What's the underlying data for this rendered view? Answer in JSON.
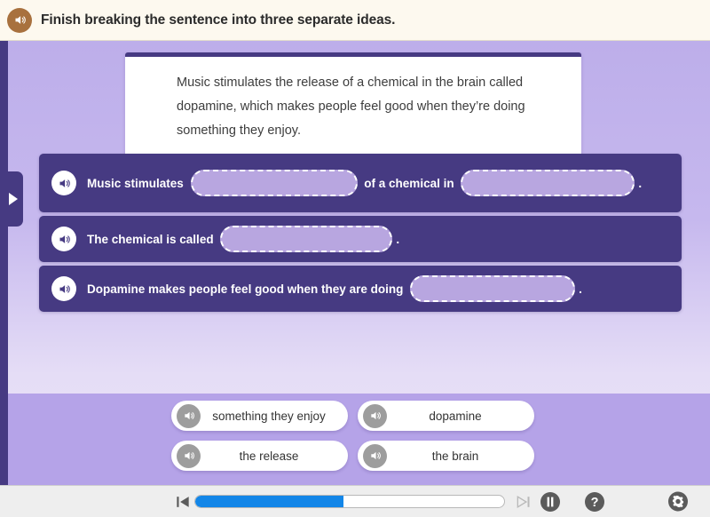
{
  "header": {
    "audio_icon": "speaker-icon",
    "instruction": "Finish breaking the sentence into three separate ideas."
  },
  "sentence_card": {
    "text": "Music stimulates the release of a chemical in the brain called dopamine, which makes people feel good when they’re doing something they enjoy."
  },
  "expander": {
    "icon": "triangle-right-icon"
  },
  "answer_rows": [
    {
      "audio_icon": "speaker-icon",
      "lead": "Music stimulates ",
      "blank1_value": "",
      "middle": " of a chemical in ",
      "blank2_value": "",
      "end": "."
    },
    {
      "audio_icon": "speaker-icon",
      "lead": "The chemical is called ",
      "blank1_value": "",
      "end": "."
    },
    {
      "audio_icon": "speaker-icon",
      "lead": "Dopamine makes people feel good when they are doing ",
      "blank1_value": "",
      "end": "."
    }
  ],
  "word_bank": {
    "chips": [
      {
        "label": "something they enjoy",
        "audio_icon": "speaker-icon"
      },
      {
        "label": "dopamine",
        "audio_icon": "speaker-icon"
      },
      {
        "label": "the release",
        "audio_icon": "speaker-icon"
      },
      {
        "label": "the brain",
        "audio_icon": "speaker-icon"
      }
    ]
  },
  "toolbar": {
    "prev_icon": "skip-previous-icon",
    "next_icon": "skip-next-icon",
    "pause_icon": "pause-icon",
    "help_icon": "question-mark-icon",
    "settings_icon": "gear-icon",
    "progress_percent": 48
  },
  "colors": {
    "header_bg": "#fdf9ef",
    "header_audio": "#a8713e",
    "row_purple": "#463a82",
    "blank_fill": "#b8a6e0",
    "tray_purple": "#b5a3e8",
    "progress_blue": "#1386e8",
    "toolbar_bg": "#eeeeee"
  }
}
